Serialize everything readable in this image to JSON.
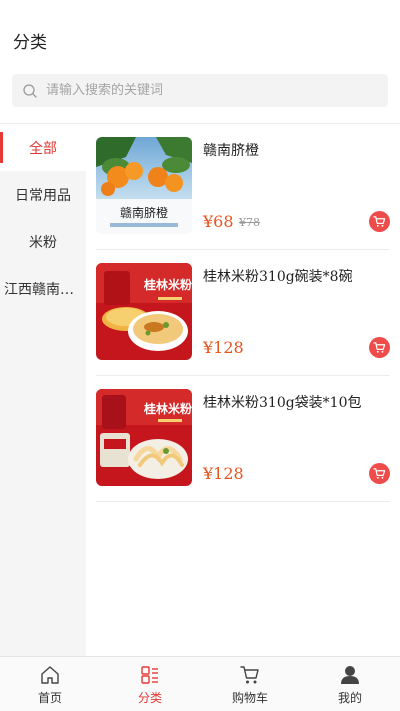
{
  "header": {
    "title": "分类"
  },
  "search": {
    "placeholder": "请输入搜索的关键词"
  },
  "sidebar": {
    "items": [
      {
        "label": "全部",
        "active": true
      },
      {
        "label": "日常用品",
        "active": false
      },
      {
        "label": "米粉",
        "active": false
      },
      {
        "label": "江西赣南脐橙",
        "active": false
      }
    ]
  },
  "products": [
    {
      "name": "赣南脐橙",
      "price": "¥68",
      "old_price": "¥78",
      "image": "navel-orange-image",
      "image_text": "赣南脐橙"
    },
    {
      "name": "桂林米粉310g碗装*8碗",
      "price": "¥128",
      "old_price": "",
      "image": "rice-noodle-bowl-image",
      "image_text": "桂林米粉"
    },
    {
      "name": "桂林米粉310g袋装*10包",
      "price": "¥128",
      "old_price": "",
      "image": "rice-noodle-bag-image",
      "image_text": "桂林米粉"
    }
  ],
  "tabbar": {
    "items": [
      {
        "label": "首页",
        "icon": "home-icon",
        "active": false
      },
      {
        "label": "分类",
        "icon": "category-icon",
        "active": true
      },
      {
        "label": "购物车",
        "icon": "cart-icon",
        "active": false
      },
      {
        "label": "我的",
        "icon": "user-icon",
        "active": false
      }
    ]
  },
  "colors": {
    "accent": "#e53935",
    "price": "#e8541e",
    "cart_button": "#ee4b4b"
  }
}
